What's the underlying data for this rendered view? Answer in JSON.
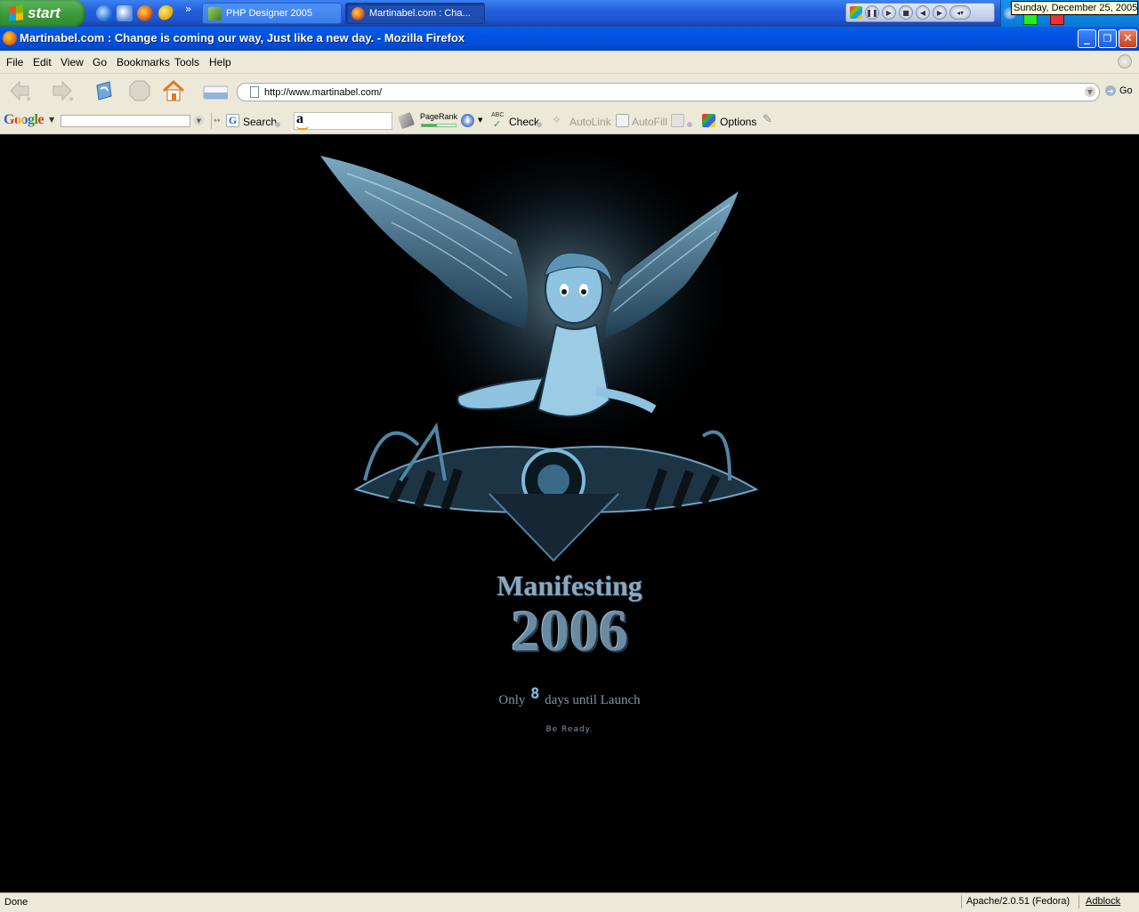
{
  "taskbar": {
    "start_label": "start",
    "tasks": [
      {
        "label": "PHP Designer 2005"
      },
      {
        "label": "Martinabel.com : Cha..."
      }
    ],
    "chevron": "»",
    "tooltip": "Sunday, December 25, 2005"
  },
  "window": {
    "title": "Martinabel.com : Change is coming our way, Just like a new day. - Mozilla Firefox",
    "min_glyph": "_",
    "max_glyph": "❐",
    "close_glyph": "✕"
  },
  "menu": {
    "items": [
      "File",
      "Edit",
      "View",
      "Go",
      "Bookmarks",
      "Tools",
      "Help"
    ]
  },
  "navigation": {
    "url": "http://www.martinabel.com/",
    "go_label": "Go"
  },
  "google_toolbar": {
    "logo": "Google",
    "search_value": "",
    "search_label": "Search",
    "pagerank_label": "PageRank",
    "check_label": "Check",
    "abc_label": "ABC",
    "autolink_label": "AutoLink",
    "autofill_label": "AutoFill",
    "options_label": "Options",
    "amazon_glyph": "a"
  },
  "content": {
    "manifesting": "Manifesting",
    "year": "2006",
    "countdown_prefix": "Only",
    "countdown_days": "8",
    "countdown_suffix": "days until Launch",
    "be_ready": "Be Ready."
  },
  "status": {
    "text": "Done",
    "server": "Apache/2.0.51 (Fedora)",
    "adblock": "Adblock"
  },
  "colors": {
    "xp_blue": "#0054e3",
    "start_green": "#3c9b3c",
    "chrome": "#ece9d8",
    "artwork_blue": "#7fb8d8"
  }
}
